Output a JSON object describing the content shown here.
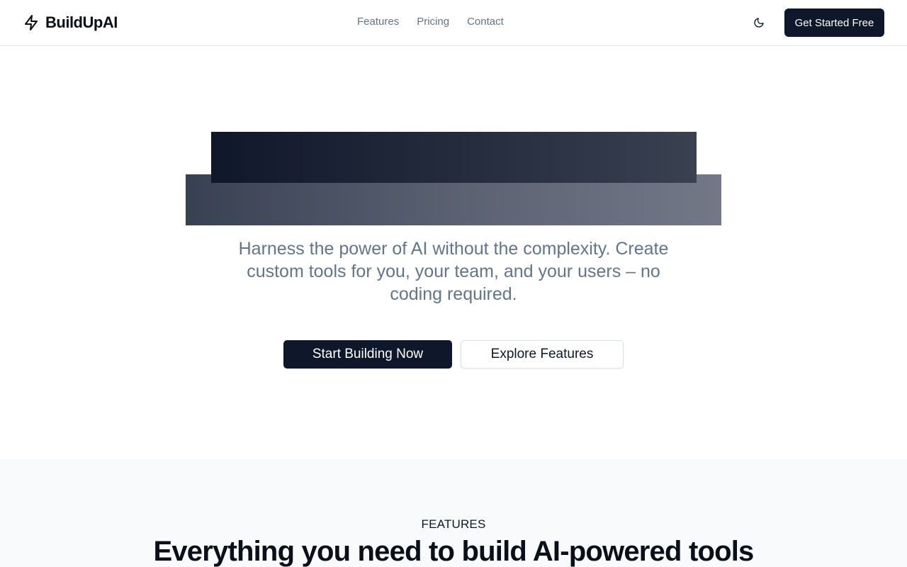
{
  "brand": {
    "name": "BuildUpAI",
    "logo_icon": "lightning-bolt-icon"
  },
  "nav": {
    "links": [
      "Features",
      "Pricing",
      "Contact"
    ]
  },
  "header": {
    "theme_toggle_icon": "moon-icon",
    "cta_label": "Get Started Free"
  },
  "hero": {
    "subtitle": "Harness the power of AI without the complexity. Create custom tools for you, your team, and your users – no coding required.",
    "primary_cta": "Start Building Now",
    "secondary_cta": "Explore Features"
  },
  "features": {
    "eyebrow": "FEATURES",
    "title": "Everything you need to build AI-powered tools"
  },
  "colors": {
    "primary": "#0f172a",
    "muted_text": "#64748b",
    "section_bg": "#f8fafc",
    "border": "#e5e7eb"
  }
}
